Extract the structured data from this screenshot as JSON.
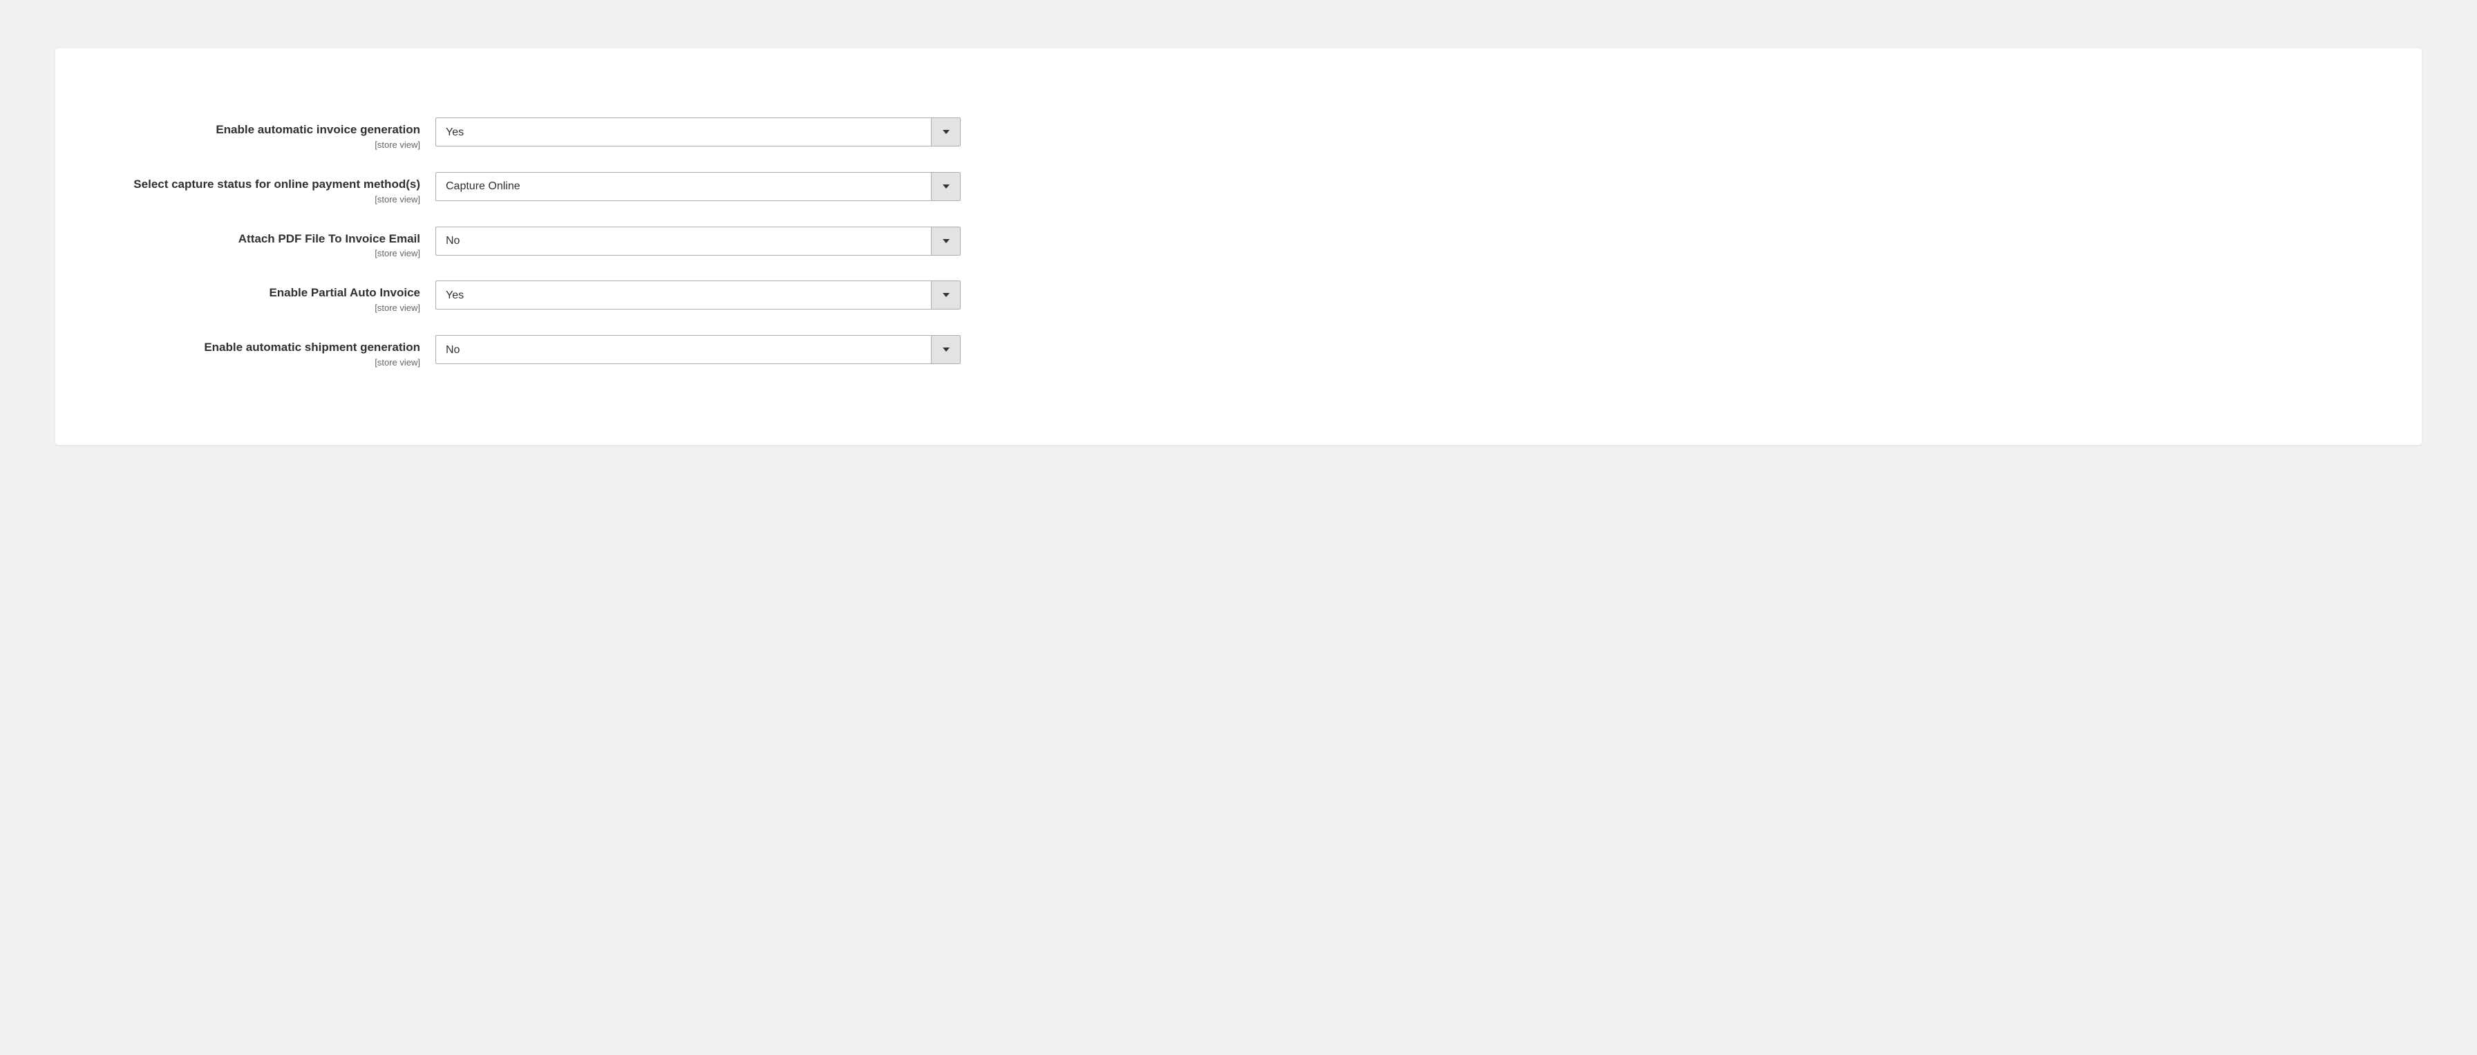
{
  "scope_label": "[store view]",
  "fields": [
    {
      "label": "Enable automatic invoice generation",
      "value": "Yes",
      "name": "enable-auto-invoice"
    },
    {
      "label": "Select capture status for online payment method(s)",
      "value": "Capture Online",
      "name": "capture-status"
    },
    {
      "label": "Attach PDF File To Invoice Email",
      "value": "No",
      "name": "attach-pdf"
    },
    {
      "label": "Enable Partial Auto Invoice",
      "value": "Yes",
      "name": "enable-partial-auto-invoice"
    },
    {
      "label": "Enable automatic shipment generation",
      "value": "No",
      "name": "enable-auto-shipment"
    }
  ]
}
